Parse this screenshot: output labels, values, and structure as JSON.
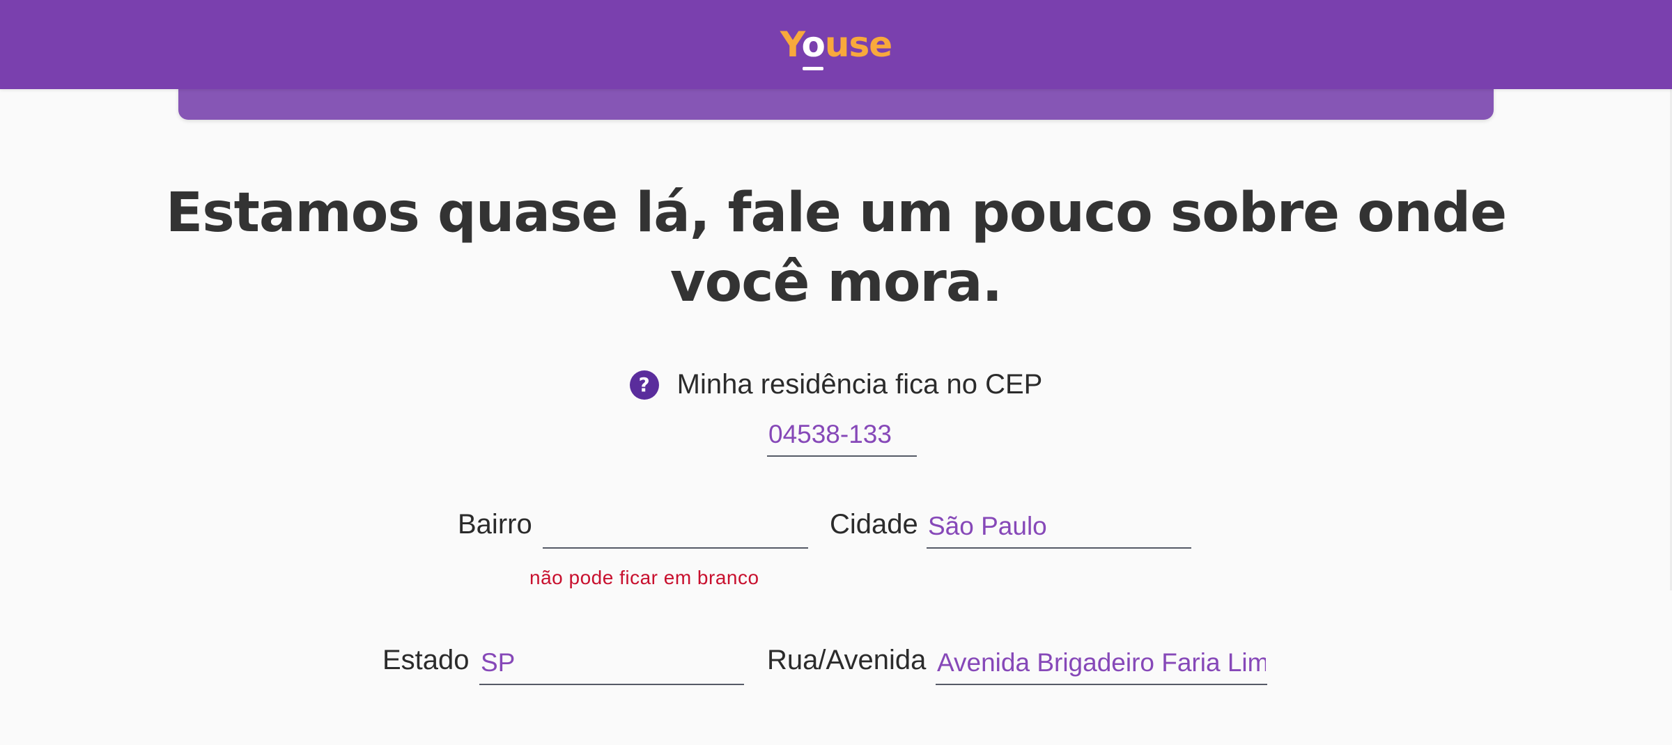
{
  "header": {
    "logo": "YOUSE",
    "logo_parts": [
      "Y",
      "o",
      "use"
    ],
    "bg_color": "#7a40ae",
    "logo_color": "#f8a93c"
  },
  "main": {
    "heading": "Estamos quase lá, fale um pouco sobre onde você mora."
  },
  "cep": {
    "help_icon": "question-circle-icon",
    "help_glyph": "?",
    "label": "Minha residência fica no CEP",
    "value": "04538-133"
  },
  "bairro": {
    "label": "Bairro",
    "value": "",
    "error": "não pode ficar em branco"
  },
  "cidade": {
    "label": "Cidade",
    "value": "São Paulo"
  },
  "estado": {
    "label": "Estado",
    "value": "SP"
  },
  "rua": {
    "label": "Rua/Avenida",
    "value": "Avenida Brigadeiro Faria Lima"
  },
  "colors": {
    "input_text": "#8648b8",
    "error": "#c8102e",
    "heading": "#333333"
  }
}
